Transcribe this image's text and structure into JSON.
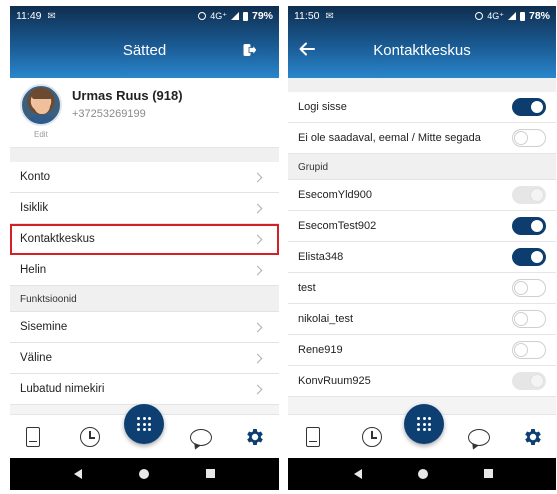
{
  "left": {
    "status": {
      "time": "11:49",
      "network": "4G⁺",
      "battery": "79%"
    },
    "header": {
      "title": "Sätted"
    },
    "profile": {
      "name": "Urmas Ruus (918)",
      "phone": "+37253269199",
      "edit_label": "Edit"
    },
    "menu": [
      {
        "label": "Konto"
      },
      {
        "label": "Isiklik"
      },
      {
        "label": "Kontaktkeskus"
      },
      {
        "label": "Helin"
      }
    ],
    "section_functions": "Funktsioonid",
    "functions": [
      {
        "label": "Sisemine"
      },
      {
        "label": "Väline"
      },
      {
        "label": "Lubatud nimekiri"
      }
    ]
  },
  "right": {
    "status": {
      "time": "11:50",
      "network": "4G⁺",
      "battery": "78%"
    },
    "header": {
      "title": "Kontaktkeskus"
    },
    "top_toggles": [
      {
        "label": "Logi sisse",
        "state": "on"
      },
      {
        "label": "Ei ole saadaval, eemal / Mitte segada",
        "state": "off"
      }
    ],
    "section_groups": "Grupid",
    "groups": [
      {
        "label": "EsecomYld900",
        "state": "disabled"
      },
      {
        "label": "EsecomTest902",
        "state": "on"
      },
      {
        "label": "Elista348",
        "state": "on"
      },
      {
        "label": "test",
        "state": "off"
      },
      {
        "label": "nikolai_test",
        "state": "off"
      },
      {
        "label": "Rene919",
        "state": "off"
      },
      {
        "label": "KonvRuum925",
        "state": "disabled"
      }
    ]
  },
  "colors": {
    "accent": "#0d3f73",
    "highlight": "#d42027"
  },
  "icons": [
    "contacts-book-icon",
    "history-clock-icon",
    "dialpad-icon",
    "chat-bubble-icon",
    "settings-gear-icon",
    "logout-icon",
    "back-arrow-icon"
  ]
}
